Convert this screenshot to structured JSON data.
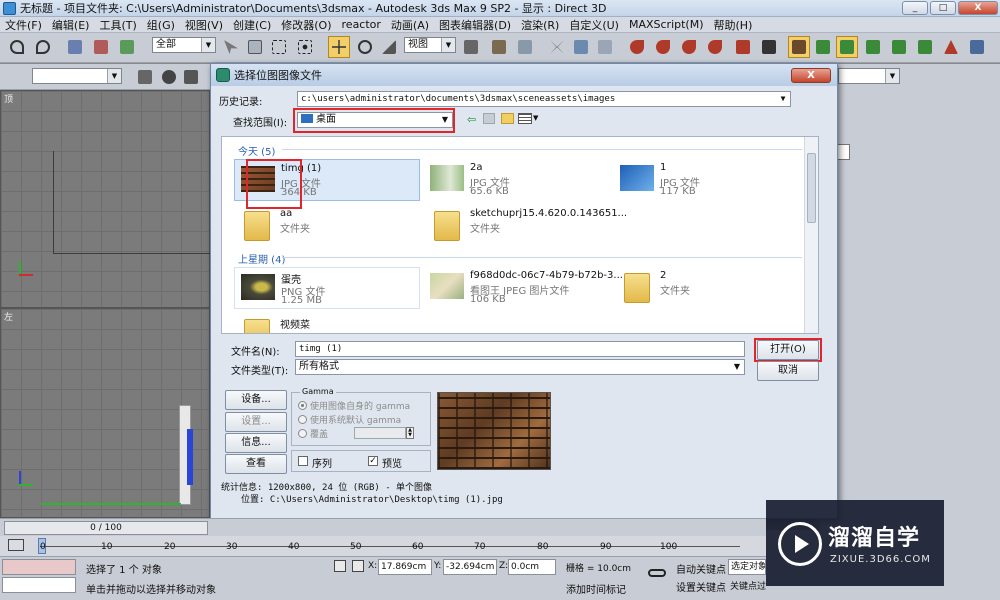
{
  "app": {
    "title": "无标题    - 项目文件夹: C:\\Users\\Administrator\\Documents\\3dsmax    - Autodesk 3ds Max 9 SP2    - 显示 : Direct 3D",
    "min": "_",
    "max": "□",
    "close": "X"
  },
  "menu": [
    "文件(F)",
    "编辑(E)",
    "工具(T)",
    "组(G)",
    "视图(V)",
    "创建(C)",
    "修改器(O)",
    "reactor",
    "动画(A)",
    "图表编辑器(D)",
    "渲染(R)",
    "自定义(U)",
    "MAXScript(M)",
    "帮助(H)"
  ],
  "toolbar": {
    "selection_filter": "全部",
    "ref_coord": "视图"
  },
  "viewports": {
    "top_label": "顶",
    "left_label": "左"
  },
  "dialog": {
    "title": "选择位图图像文件",
    "close": "X",
    "history_label": "历史记录:",
    "history_value": "c:\\users\\administrator\\documents\\3dsmax\\sceneassets\\images",
    "lookin_label": "查找范围(I):",
    "lookin_value": "桌面",
    "groups": [
      {
        "label": "今天 (5)"
      },
      {
        "label": "上星期 (4)"
      }
    ],
    "files": [
      {
        "name": "timg (1)",
        "type": "JPG 文件",
        "size": "364 KB"
      },
      {
        "name": "2a",
        "type": "JPG 文件",
        "size": "65.6 KB"
      },
      {
        "name": "1",
        "type": "JPG 文件",
        "size": "117 KB"
      },
      {
        "name": "aa",
        "type": "文件夹",
        "size": ""
      },
      {
        "name": "sketchuprj15.4.620.0.143651...",
        "type": "文件夹",
        "size": ""
      },
      {
        "name": "蛋壳",
        "type": "PNG 文件",
        "size": "1.25 MB"
      },
      {
        "name": "f968d0dc-06c7-4b79-b72b-3...",
        "type": "看图王 JPEG 图片文件",
        "size": "106 KB"
      },
      {
        "name": "2",
        "type": "文件夹",
        "size": ""
      },
      {
        "name": "视频菜",
        "type": "",
        "size": ""
      }
    ],
    "filename_label": "文件名(N):",
    "filename_value": "timg (1)",
    "filetype_label": "文件类型(T):",
    "filetype_value": "所有格式",
    "open_button": "打开(O)",
    "cancel_button": "取消",
    "setup_button": "设备...",
    "settings_button": "设置...",
    "info_button": "信息...",
    "view_button": "查看",
    "gamma": {
      "title": "Gamma",
      "opt1": "使用图像自身的 gamma",
      "opt2": "使用系统默认 gamma",
      "opt3": "覆盖"
    },
    "sequence_label": "序列",
    "preview_label": "预览",
    "preview_check": "✓",
    "stats_text": "统计信息: 1200x800, 24 位 (RGB) - 单个图像",
    "location_text": "位置: C:\\Users\\Administrator\\Desktop\\timg (1).jpg"
  },
  "timeline": {
    "frame_text": "0 / 100",
    "ticks": [
      "0",
      "10",
      "20",
      "30",
      "40",
      "50",
      "60",
      "70",
      "80",
      "90",
      "100"
    ]
  },
  "status": {
    "selected": "选择了 1 个 对象",
    "prompt": "单击并拖动以选择并移动对象",
    "x_label": "X:",
    "x_value": "17.869cm",
    "y_label": "Y:",
    "y_value": "-32.694cm",
    "z_label": "Z:",
    "z_value": "0.0cm",
    "grid": "栅格 = 10.0cm",
    "auto_key": "自动关键点",
    "set_key": "设置关键点",
    "selected_obj": "选定对象",
    "add_time_tag": "添加时间标记",
    "key_filters": "关键点过滤器"
  },
  "watermark": {
    "title": "溜溜自学",
    "subtitle": "ZIXUE.3D66.COM"
  }
}
